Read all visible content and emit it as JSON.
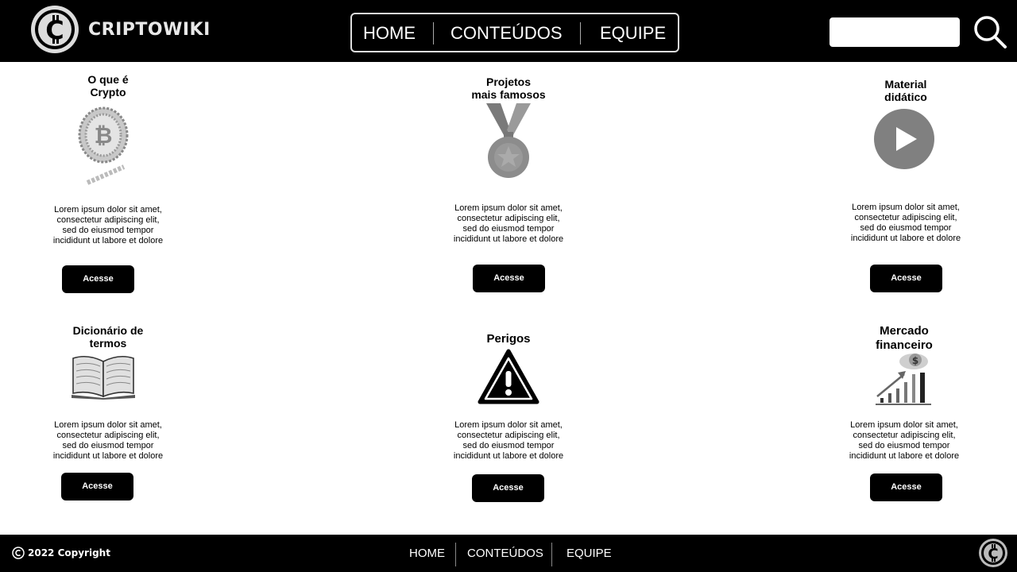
{
  "header": {
    "logo_text": "CRIPTOWIKI",
    "nav": [
      "HOME",
      "CONTEÚDOS",
      "EQUIPE"
    ],
    "search": {
      "value": "",
      "placeholder": ""
    }
  },
  "cards": [
    {
      "title": "O que é\nCrypto",
      "icon": "coin-icon",
      "desc": "Lorem ipsum dolor sit amet,\nconsectetur adipiscing elit,\nsed do eiusmod tempor\nincididunt ut labore et dolore",
      "button": "Acesse"
    },
    {
      "title": "Projetos\nmais famosos",
      "icon": "medal-icon",
      "desc": "Lorem ipsum dolor sit amet,\nconsectetur adipiscing elit,\nsed do eiusmod tempor\nincididunt ut labore et dolore",
      "button": "Acesse"
    },
    {
      "title": "Material\ndidático",
      "icon": "play-icon",
      "desc": "Lorem ipsum dolor sit amet,\nconsectetur adipiscing elit,\nsed do eiusmod tempor\nincididunt ut labore et dolore",
      "button": "Acesse"
    },
    {
      "title": "Dicionário de\ntermos",
      "icon": "book-icon",
      "desc": "Lorem ipsum dolor sit amet,\nconsectetur adipiscing elit,\nsed do eiusmod tempor\nincididunt ut labore et dolore",
      "button": "Acesse"
    },
    {
      "title": "Perigos",
      "icon": "warning-icon",
      "desc": "Lorem ipsum dolor sit amet,\nconsectetur adipiscing elit,\nsed do eiusmod tempor\nincididunt ut labore et dolore",
      "button": "Acesse"
    },
    {
      "title": "Mercado\nfinanceiro",
      "icon": "finance-chart-icon",
      "desc": "Lorem ipsum dolor sit amet,\nconsectetur adipiscing elit,\nsed do eiusmod tempor\nincididunt ut labore et dolore",
      "button": "Acesse"
    }
  ],
  "footer": {
    "copyright": "2022 Copyright",
    "nav": [
      "HOME",
      "CONTEÚDOS",
      "EQUIPE"
    ]
  },
  "colors": {
    "bar": "#000000",
    "background": "#ffffff",
    "icon_gray": "#808080"
  }
}
